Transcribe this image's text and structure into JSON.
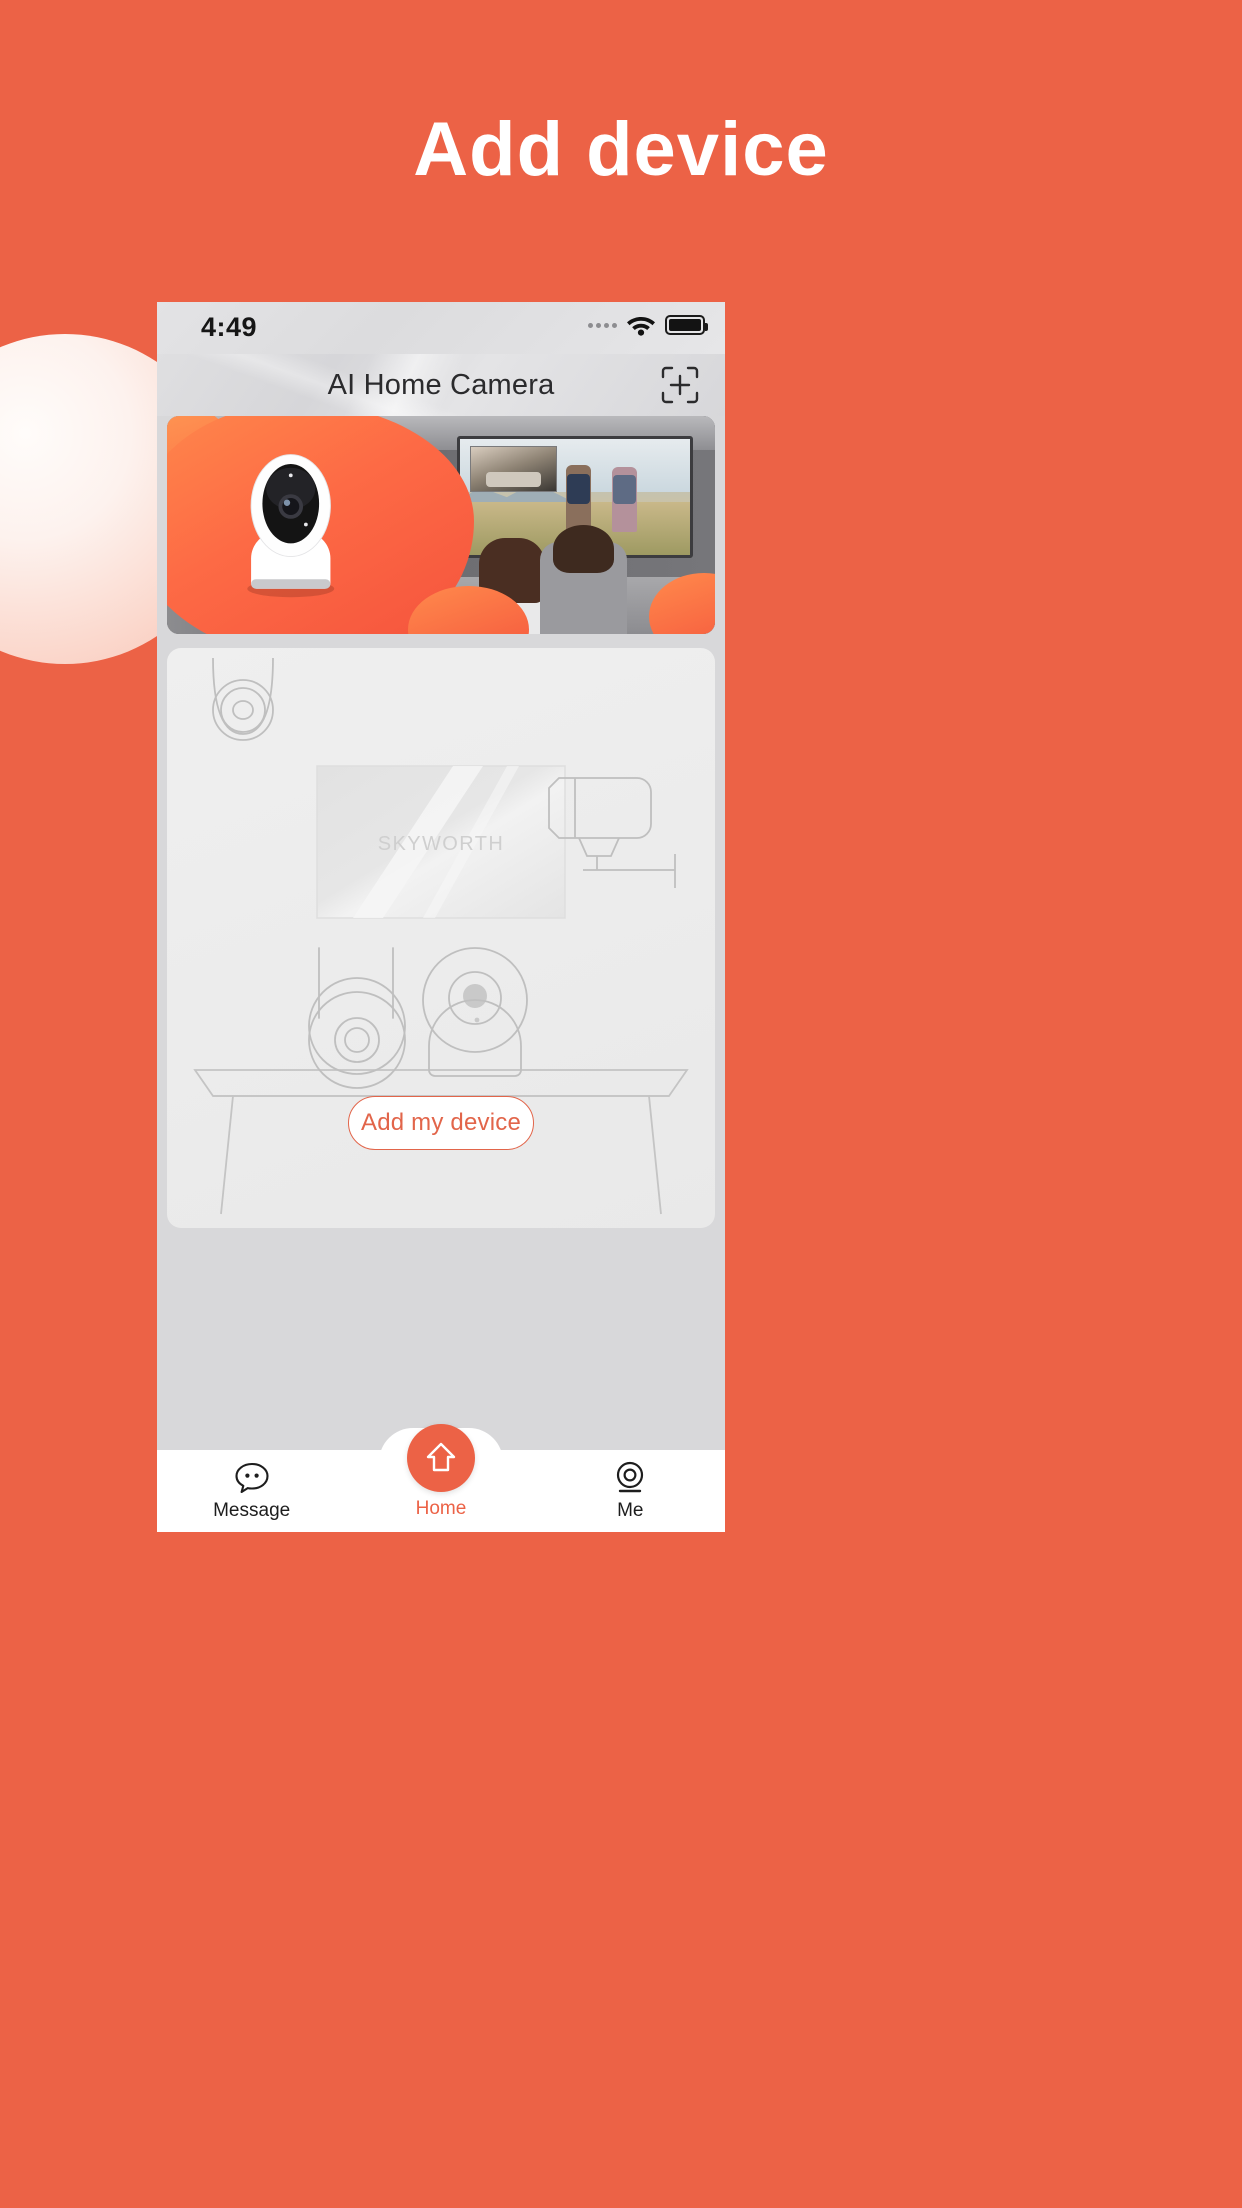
{
  "page": {
    "title": "Add device",
    "background_color": "#EC6246",
    "accent_color": "#EC6246"
  },
  "phone": {
    "status_bar": {
      "time": "4:49",
      "signal_dots_icon": "signal-dots-icon",
      "wifi_icon": "wifi-icon",
      "battery_icon": "battery-full-icon"
    },
    "app_header": {
      "title": "AI Home Camera",
      "action_icon": "scan-add-icon"
    },
    "banner": {
      "alt_text": "AI home camera product promo",
      "product_icon": "security-camera-icon"
    },
    "empty_state": {
      "tv_brand": "SKYWORTH",
      "illustration_icons": [
        "ceiling-dome-camera-icon",
        "bullet-camera-icon",
        "antenna-camera-icon",
        "desk-camera-icon",
        "table-icon",
        "tv-icon"
      ],
      "add_button_label": "Add my device",
      "add_button_color": "#E2654A"
    },
    "tab_bar": {
      "items": [
        {
          "label": "Message",
          "icon": "message-bubble-icon",
          "active": false
        },
        {
          "label": "Home",
          "icon": "home-icon",
          "active": true
        },
        {
          "label": "Me",
          "icon": "profile-icon",
          "active": false
        }
      ]
    }
  }
}
